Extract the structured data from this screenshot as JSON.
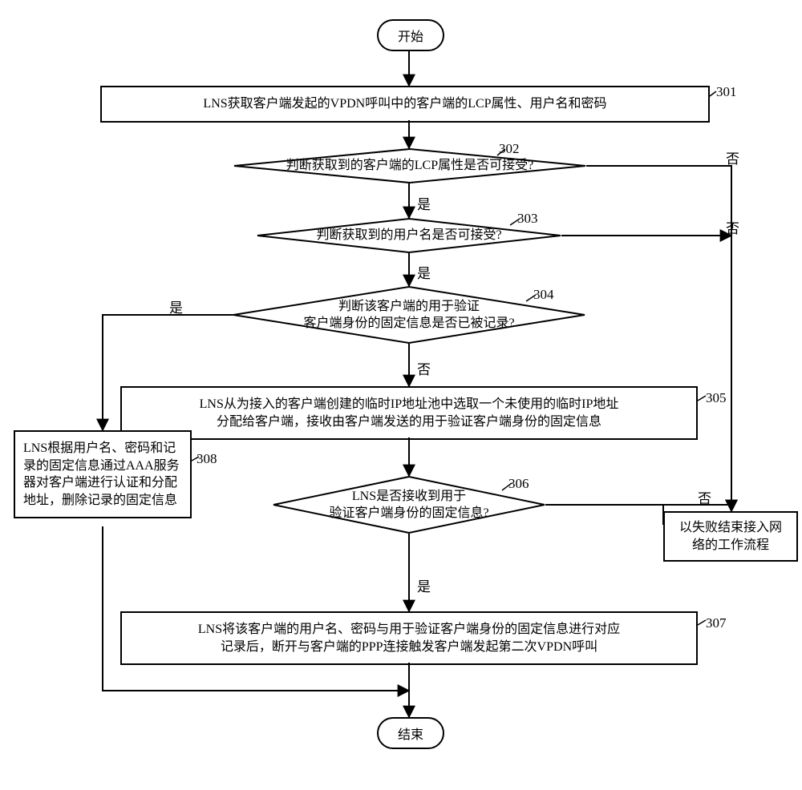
{
  "chart_data": {
    "type": "flowchart",
    "nodes": [
      {
        "id": "start",
        "kind": "terminator",
        "label": "开始"
      },
      {
        "id": "p301",
        "kind": "process",
        "label": "LNS获取客户端发起的VPDN呼叫中的客户端的LCP属性、用户名和密码",
        "step": "301"
      },
      {
        "id": "d302",
        "kind": "decision",
        "label": "判断获取到的客户端的LCP属性是否可接受?",
        "step": "302"
      },
      {
        "id": "d303",
        "kind": "decision",
        "label": "判断获取到的用户名是否可接受?",
        "step": "303"
      },
      {
        "id": "d304",
        "kind": "decision",
        "label": "判断该客户端的用于验证\n客户端身份的固定信息是否已被记录?",
        "step": "304"
      },
      {
        "id": "p305",
        "kind": "process",
        "label": "LNS从为接入的客户端创建的临时IP地址池中选取一个未使用的临时IP地址\n分配给客户端，接收由客户端发送的用于验证客户端身份的固定信息",
        "step": "305"
      },
      {
        "id": "d306",
        "kind": "decision",
        "label": "LNS是否接收到用于\n验证客户端身份的固定信息?",
        "step": "306"
      },
      {
        "id": "p307",
        "kind": "process",
        "label": "LNS将该客户端的用户名、密码与用于验证客户端身份的固定信息进行对应\n记录后，断开与客户端的PPP连接触发客户端发起第二次VPDN呼叫",
        "step": "307"
      },
      {
        "id": "p308",
        "kind": "process",
        "label": "LNS根据用户名、密码和记\n录的固定信息通过AAA服务\n器对客户端进行认证和分配\n地址，删除记录的固定信息",
        "step": "308"
      },
      {
        "id": "fail",
        "kind": "process",
        "label": "以失败结束接入网\n络的工作流程"
      },
      {
        "id": "end",
        "kind": "terminator",
        "label": "结束"
      }
    ],
    "edges": [
      {
        "from": "start",
        "to": "p301"
      },
      {
        "from": "p301",
        "to": "d302"
      },
      {
        "from": "d302",
        "to": "d303",
        "label": "是"
      },
      {
        "from": "d302",
        "to": "fail",
        "label": "否"
      },
      {
        "from": "d303",
        "to": "d304",
        "label": "是"
      },
      {
        "from": "d303",
        "to": "fail",
        "label": "否"
      },
      {
        "from": "d304",
        "to": "p305",
        "label": "否"
      },
      {
        "from": "d304",
        "to": "p308",
        "label": "是"
      },
      {
        "from": "p305",
        "to": "d306"
      },
      {
        "from": "d306",
        "to": "p307",
        "label": "是"
      },
      {
        "from": "d306",
        "to": "fail",
        "label": "否"
      },
      {
        "from": "p307",
        "to": "end"
      },
      {
        "from": "p308",
        "to": "end"
      }
    ],
    "labels": {
      "yes": "是",
      "no": "否"
    }
  },
  "terminators": {
    "start_label": "开始",
    "end_label": "结束"
  },
  "steps": {
    "p301": {
      "text": "LNS获取客户端发起的VPDN呼叫中的客户端的LCP属性、用户名和密码",
      "num": "301"
    },
    "d302": {
      "text": "判断获取到的客户端的LCP属性是否可接受?",
      "num": "302"
    },
    "d303": {
      "text": "判断获取到的用户名是否可接受?",
      "num": "303"
    },
    "d304": {
      "line1": "判断该客户端的用于验证",
      "line2": "客户端身份的固定信息是否已被记录?",
      "num": "304"
    },
    "p305": {
      "line1": "LNS从为接入的客户端创建的临时IP地址池中选取一个未使用的临时IP地址",
      "line2": "分配给客户端，接收由客户端发送的用于验证客户端身份的固定信息",
      "num": "305"
    },
    "d306": {
      "line1": "LNS是否接收到用于",
      "line2": "验证客户端身份的固定信息?",
      "num": "306"
    },
    "p307": {
      "line1": "LNS将该客户端的用户名、密码与用于验证客户端身份的固定信息进行对应",
      "line2": "记录后，断开与客户端的PPP连接触发客户端发起第二次VPDN呼叫",
      "num": "307"
    },
    "p308": {
      "line1": "LNS根据用户名、密码和记",
      "line2": "录的固定信息通过AAA服务",
      "line3": "器对客户端进行认证和分配",
      "line4": "地址，删除记录的固定信息",
      "num": "308"
    },
    "fail": {
      "line1": "以失败结束接入网",
      "line2": "络的工作流程"
    }
  },
  "labels": {
    "yes": "是",
    "no": "否"
  }
}
